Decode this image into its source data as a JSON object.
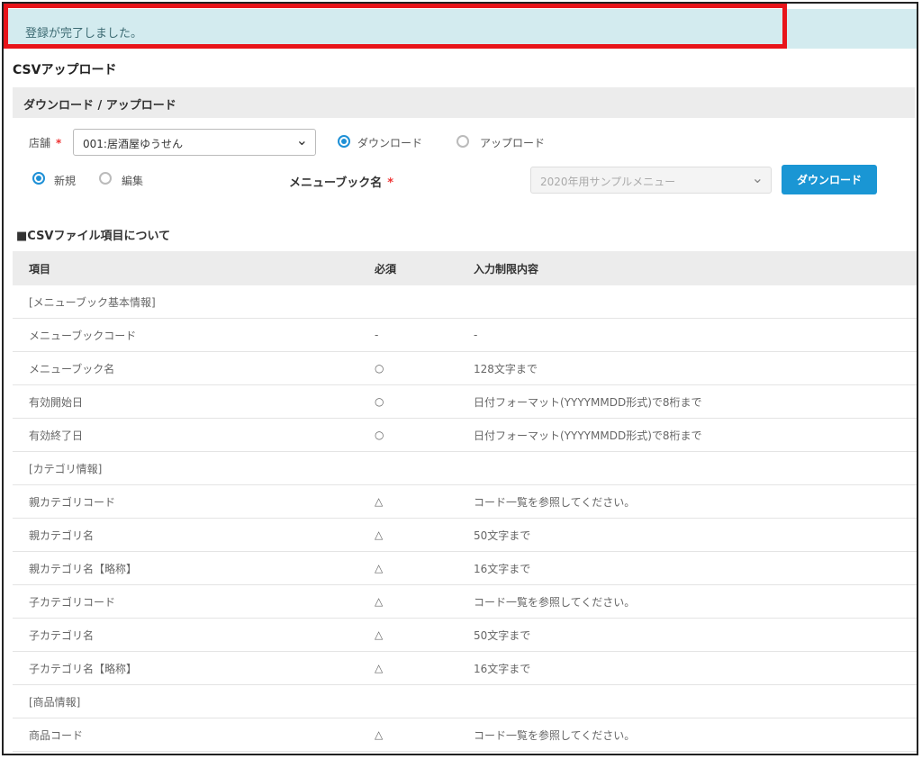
{
  "alert": {
    "message": "登録が完了しました。"
  },
  "page_title": "CSVアップロード",
  "section_title": "ダウンロード / アップロード",
  "form": {
    "store_label": "店舗",
    "required_mark": "*",
    "store_value": "001:居酒屋ゆうせん",
    "mode_download_label": "ダウンロード",
    "mode_upload_label": "アップロード",
    "mode_selected": "download",
    "type_new_label": "新規",
    "type_edit_label": "編集",
    "type_selected": "new",
    "menu_book_label": "メニューブック名",
    "menu_book_value": "2020年用サンプルメニュー",
    "download_button": "ダウンロード"
  },
  "info_heading": "■CSVファイル項目について",
  "table": {
    "headers": [
      "項目",
      "必須",
      "入力制限内容"
    ],
    "rows": [
      [
        "[メニューブック基本情報]",
        "",
        ""
      ],
      [
        "メニューブックコード",
        "-",
        "-"
      ],
      [
        "メニューブック名",
        "○",
        "128文字まで"
      ],
      [
        "有効開始日",
        "○",
        "日付フォーマット(YYYYMMDD形式)で8桁まで"
      ],
      [
        "有効終了日",
        "○",
        "日付フォーマット(YYYYMMDD形式)で8桁まで"
      ],
      [
        "[カテゴリ情報]",
        "",
        ""
      ],
      [
        "親カテゴリコード",
        "△",
        "コード一覧を参照してください。"
      ],
      [
        "親カテゴリ名",
        "△",
        "50文字まで"
      ],
      [
        "親カテゴリ名【略称】",
        "△",
        "16文字まで"
      ],
      [
        "子カテゴリコード",
        "△",
        "コード一覧を参照してください。"
      ],
      [
        "子カテゴリ名",
        "△",
        "50文字まで"
      ],
      [
        "子カテゴリ名【略称】",
        "△",
        "16文字まで"
      ],
      [
        "[商品情報]",
        "",
        ""
      ],
      [
        "商品コード",
        "△",
        "コード一覧を参照してください。"
      ]
    ]
  },
  "colors": {
    "alert_bg": "#d3ebef",
    "highlight_border": "#e8141a",
    "accent": "#1a96d4",
    "required": "#e33333"
  },
  "icons": {
    "select_arrow": "chevron-down-icon"
  }
}
